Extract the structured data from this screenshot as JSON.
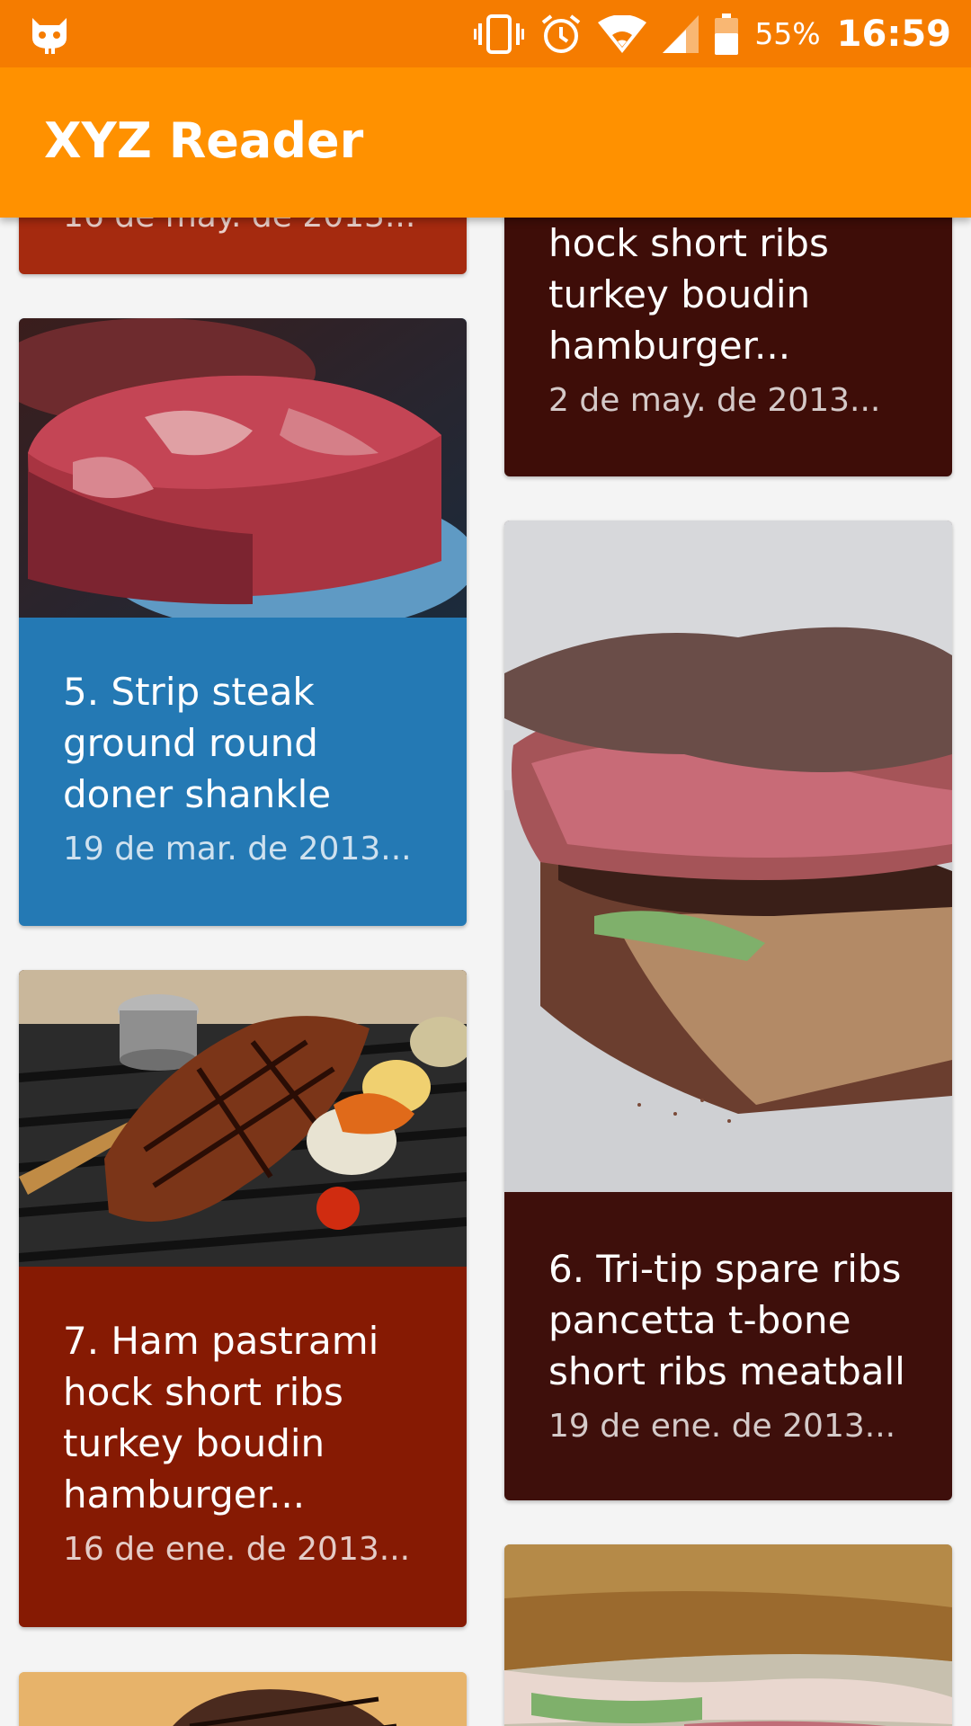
{
  "status_bar": {
    "battery": "55%",
    "time": "16:59",
    "icons": [
      "notification-cat-icon",
      "vibrate-icon",
      "alarm-icon",
      "wifi-icon",
      "cell-signal-icon",
      "battery-icon"
    ]
  },
  "app_bar": {
    "title": "XYZ Reader",
    "color": "#ff9100"
  },
  "articles": [
    {
      "title": "",
      "date": "16 de may. de 2013...",
      "color": "#a52a0f"
    },
    {
      "title": "hock short ribs turkey boudin hamburger...",
      "date": "2 de may. de 2013...",
      "color": "#3e0d08"
    },
    {
      "title": "5. Strip steak ground round doner shankle",
      "date": "19 de mar. de 2013...",
      "color": "#2479b4"
    },
    {
      "title": "6. Tri-tip spare ribs pancetta t-bone short ribs meatball",
      "date": "19 de ene. de 2013...",
      "color": "#3e0f0b"
    },
    {
      "title": "7. Ham pastrami hock short ribs turkey boudin hamburger...",
      "date": "16 de ene. de 2013...",
      "color": "#861a03"
    },
    {
      "title": "",
      "date": "",
      "color": "#e7b36a"
    },
    {
      "title": "",
      "date": "",
      "color": "#8a5b2c"
    }
  ]
}
